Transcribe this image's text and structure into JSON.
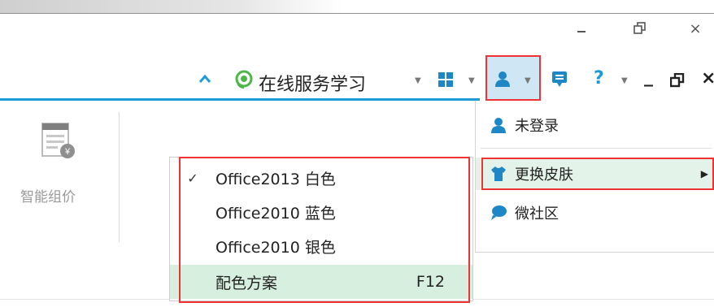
{
  "window": {
    "minimize_icon": "minimize-icon",
    "restore_icon": "restore-icon",
    "close_label": "×"
  },
  "ribbon": {
    "online_service_label": "在线服务学习",
    "help_label": "?",
    "inner_window": {
      "minimize_label": "_",
      "restore_icon": "restore-icon",
      "close_label": "×"
    },
    "left_panel": {
      "tool_label": "智能组价",
      "tool_icon": "price-sheet-icon"
    }
  },
  "account_menu": {
    "items": [
      {
        "label": "未登录",
        "icon": "user-icon"
      },
      {
        "label": "更换皮肤",
        "icon": "shirt-icon",
        "has_submenu": true
      },
      {
        "label": "微社区",
        "icon": "chat-bubble-icon"
      }
    ],
    "submenu_arrow": "▶"
  },
  "skin_submenu": {
    "items": [
      {
        "label": "Office2013 白色",
        "checked": true,
        "check": "✓",
        "shortcut": ""
      },
      {
        "label": "Office2010 蓝色",
        "checked": false,
        "check": "",
        "shortcut": ""
      },
      {
        "label": "Office2010 银色",
        "checked": false,
        "check": "",
        "shortcut": ""
      },
      {
        "label": "配色方案",
        "checked": false,
        "check": "",
        "shortcut": "F12"
      }
    ]
  },
  "colors": {
    "accent_blue": "#1e9bd7",
    "highlight_red": "#e33",
    "hover_green": "#e3f3ea",
    "selected_green": "#d7efdf",
    "online_green": "#4db848"
  }
}
